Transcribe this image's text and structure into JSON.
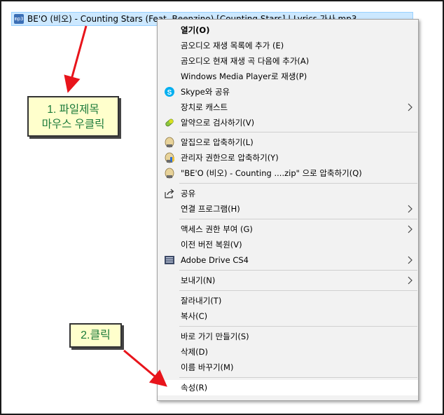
{
  "file": {
    "name": "BE'O (비오) - Counting Stars (Feat. Beenzino) [Counting Stars] | Lyrics 가사.mp3",
    "icon": "mp3-file-icon"
  },
  "menu": {
    "items": [
      {
        "label": "열기(O)",
        "bold": true
      },
      {
        "label": "곰오디오 재생 목록에 추가 (E)"
      },
      {
        "label": "곰오디오 현재 재생 곡 다음에 추가(A)"
      },
      {
        "label": "Windows Media Player로 재생(P)"
      },
      {
        "label": "Skype와 공유",
        "icon": "skype-icon"
      },
      {
        "label": "장치로 캐스트",
        "submenu": true
      },
      {
        "label": "알약으로 검사하기(V)",
        "icon": "alyac-pill-icon"
      },
      {
        "label": "알집으로 압축하기(L)",
        "icon": "alzip-icon"
      },
      {
        "label": "관리자 권한으로 압축하기(Y)",
        "icon": "alzip-admin-icon"
      },
      {
        "label": "\"BE'O (비오) - Counting ....zip\" 으로 압축하기(Q)",
        "icon": "alzip-icon"
      },
      {
        "label": "공유",
        "icon": "share-icon"
      },
      {
        "label": "연결 프로그램(H)",
        "submenu": true
      },
      {
        "label": "액세스 권한 부여 (G)",
        "submenu": true
      },
      {
        "label": "이전 버전 복원(V)"
      },
      {
        "label": "Adobe Drive CS4",
        "icon": "adobe-drive-icon",
        "submenu": true
      },
      {
        "label": "보내기(N)",
        "submenu": true
      },
      {
        "label": "잘라내기(T)"
      },
      {
        "label": "복사(C)"
      },
      {
        "label": "바로 가기 만들기(S)"
      },
      {
        "label": "삭제(D)"
      },
      {
        "label": "이름 바꾸기(M)"
      },
      {
        "label": "속성(R)",
        "highlighted": true
      }
    ]
  },
  "annotations": {
    "note1_line1": "1. 파일제목",
    "note1_line2": "마우스 우클릭",
    "note2": "2.클릭",
    "text_color": "#1b7a3a",
    "arrow_color": "#e8141b"
  }
}
